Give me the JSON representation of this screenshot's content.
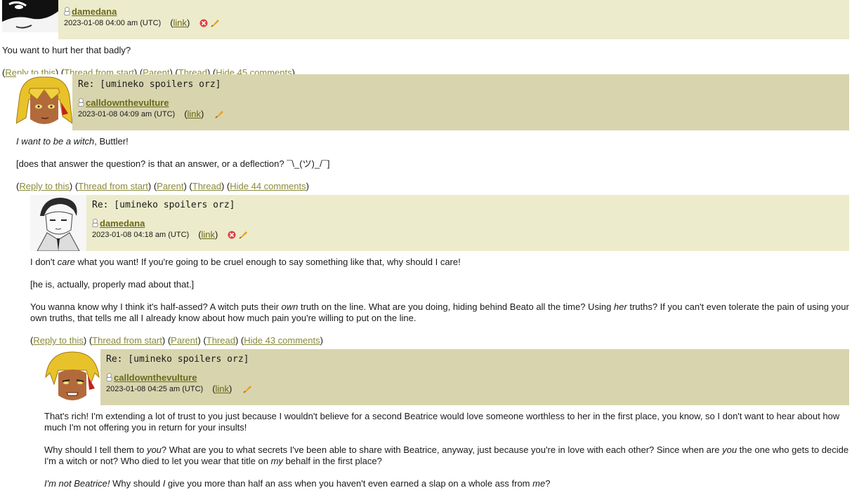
{
  "comments": [
    {
      "subject": "",
      "username": "damedana",
      "timestamp": "2023-01-08 04:00 am (UTC)",
      "link_label": "link",
      "paragraphs": [
        "You want to hurt her that badly?"
      ],
      "actions": {
        "reply": "Reply to this",
        "thread_start": "Thread from start",
        "parent": "Parent",
        "thread": "Thread",
        "hide": "Hide 45 comments"
      }
    },
    {
      "subject": "Re: [umineko spoilers orz]",
      "username": "calldownthevulture",
      "timestamp": "2023-01-08 04:09 am (UTC)",
      "link_label": "link",
      "paragraphs": [
        "Buttler!",
        "[does that answer the question? is that an answer, or a deflection? ¯\\_(ツ)_/¯]"
      ],
      "italic_lead": "I want to be a witch",
      "actions": {
        "reply": "Reply to this",
        "thread_start": "Thread from start",
        "parent": "Parent",
        "thread": "Thread",
        "hide": "Hide 44 comments"
      }
    },
    {
      "subject": "Re: [umineko spoilers orz]",
      "username": "damedana",
      "timestamp": "2023-01-08 04:18 am (UTC)",
      "link_label": "link",
      "p1": [
        "I don't ",
        "care",
        " what you want! If you're going to be cruel enough to say something like that, why should I care!"
      ],
      "p2": "[he is, actually, properly mad about that.]",
      "p3": [
        "You wanna know why I think it's half-assed? A witch puts their ",
        "own",
        " truth on the line. What are you doing, hiding behind Beato all the time? Using ",
        "her",
        " truths? If you can't even tolerate the pain of using your own truths, that tells me all I already know about how much pain you're willing to put on the line."
      ],
      "actions": {
        "reply": "Reply to this",
        "thread_start": "Thread from start",
        "parent": "Parent",
        "thread": "Thread",
        "hide": "Hide 43 comments"
      }
    },
    {
      "subject": "Re: [umineko spoilers orz]",
      "username": "calldownthevulture",
      "timestamp": "2023-01-08 04:25 am (UTC)",
      "link_label": "link",
      "p1": "That's rich! I'm extending a lot of trust to you just because I wouldn't believe for a second Beatrice would love someone worthless to her in the first place, you know, so I don't want to hear about how much I'm not offering you in return for your insults!",
      "p2": [
        "Why should I tell them to ",
        "you",
        "? What are you to what secrets I've been able to share with Beatrice, anyway, just because you're in love with each other? Since when are ",
        "you",
        " the one who gets to decide I'm a witch or not? Who died to let you wear that title on ",
        "my",
        " behalf in the first place?"
      ],
      "p3": [
        "I'm not Beatrice!",
        " Why should ",
        "I",
        " give you more than half an ass when you haven't even earned a slap on a whole ass from ",
        "me",
        "?"
      ]
    }
  ],
  "colors": {
    "header_light": "#ecebcc",
    "header_dark": "#d8d4ae",
    "link": "#8a8a3a",
    "username": "#6b6a1a"
  }
}
